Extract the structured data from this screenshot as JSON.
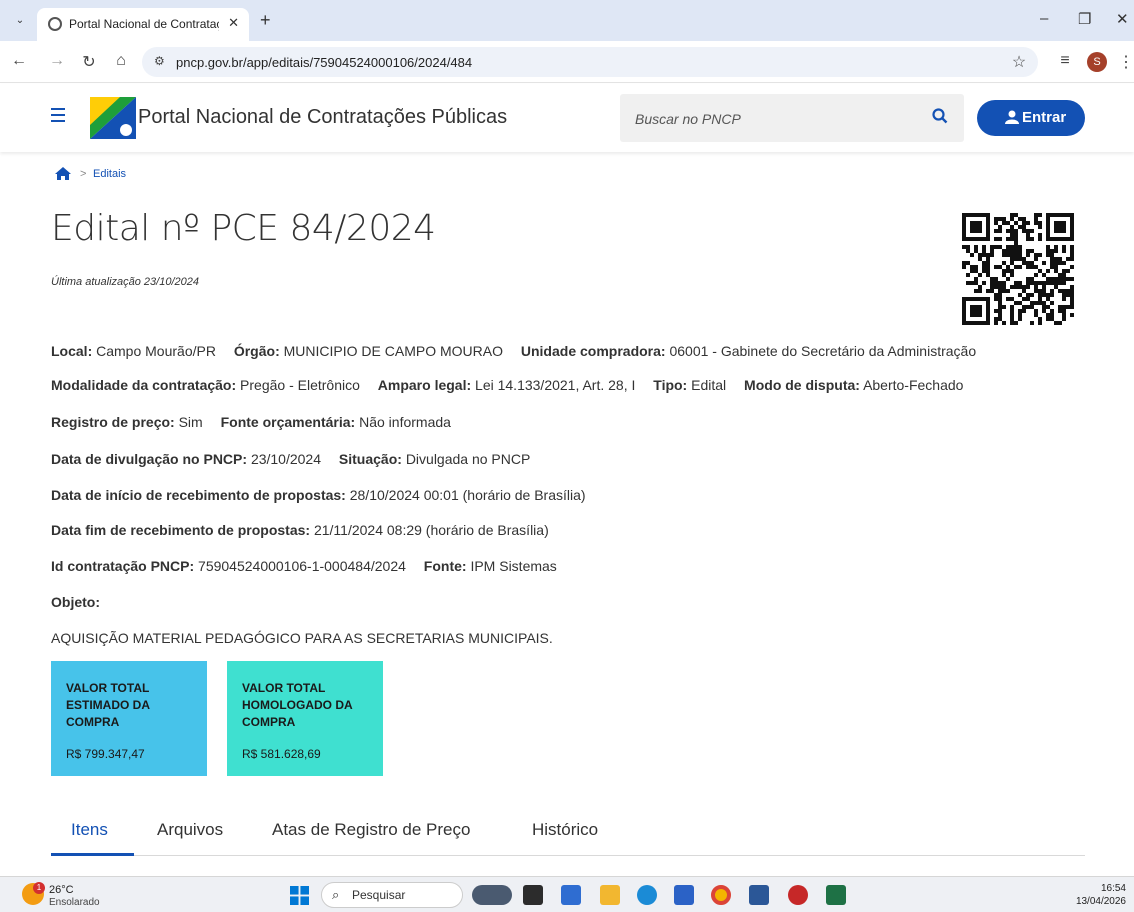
{
  "browser": {
    "tab_title": "Portal Nacional de Contrataçõe",
    "url": "pncp.gov.br/app/editais/75904524000106/2024/484",
    "profile_initial": "S"
  },
  "header": {
    "brand": "Portal Nacional de Contratações Públicas",
    "search_placeholder": "Buscar no PNCP",
    "login_label": "Entrar"
  },
  "breadcrumb": {
    "link": "Editais"
  },
  "page": {
    "title": "Edital nº PCE 84/2024",
    "updated": "Última atualização 23/10/2024"
  },
  "details": {
    "local_label": "Local:",
    "local": "Campo Mourão/PR",
    "orgao_label": "Órgão:",
    "orgao": "MUNICIPIO DE CAMPO MOURAO",
    "unidade_label": "Unidade compradora:",
    "unidade": "06001 - Gabinete do Secretário da Administração",
    "modalidade_label": "Modalidade da contratação:",
    "modalidade": "Pregão - Eletrônico",
    "amparo_label": "Amparo legal:",
    "amparo": "Lei 14.133/2021, Art. 28, I",
    "tipo_label": "Tipo:",
    "tipo": "Edital",
    "modo_label": "Modo de disputa:",
    "modo": "Aberto-Fechado",
    "registro_label": "Registro de preço:",
    "registro": "Sim",
    "fonte_orc_label": "Fonte orçamentária:",
    "fonte_orc": "Não informada",
    "divulgacao_label": "Data de divulgação no PNCP:",
    "divulgacao": "23/10/2024",
    "situacao_label": "Situação:",
    "situacao": "Divulgada no PNCP",
    "inicio_label": "Data de início de recebimento de propostas:",
    "inicio": "28/10/2024 00:01 (horário de Brasília)",
    "fim_label": "Data fim de recebimento de propostas:",
    "fim": "21/11/2024 08:29 (horário de Brasília)",
    "id_label": "Id contratação PNCP:",
    "id": "75904524000106-1-000484/2024",
    "fonte_label": "Fonte:",
    "fonte": "IPM Sistemas",
    "objeto_label": "Objeto:",
    "objeto": "AQUISIÇÃO MATERIAL PEDAGÓGICO PARA AS SECRETARIAS MUNICIPAIS."
  },
  "totals": {
    "estimado_label": "VALOR TOTAL ESTIMADO DA COMPRA",
    "estimado_value": "R$ 799.347,47",
    "homologado_label": "VALOR TOTAL HOMOLOGADO DA COMPRA",
    "homologado_value": "R$ 581.628,69"
  },
  "tabs": [
    "Itens",
    "Arquivos",
    "Atas de Registro de Preço",
    "Histórico"
  ],
  "taskbar": {
    "temp": "26°C",
    "weather": "Ensolarado",
    "search": "Pesquisar",
    "time": "16:54",
    "date": "13/04/2026",
    "badge": "1"
  },
  "colors": {
    "primary": "#1351b4",
    "estimado_bg": "#47c3ea",
    "homologado_bg": "#3fe0d0"
  }
}
